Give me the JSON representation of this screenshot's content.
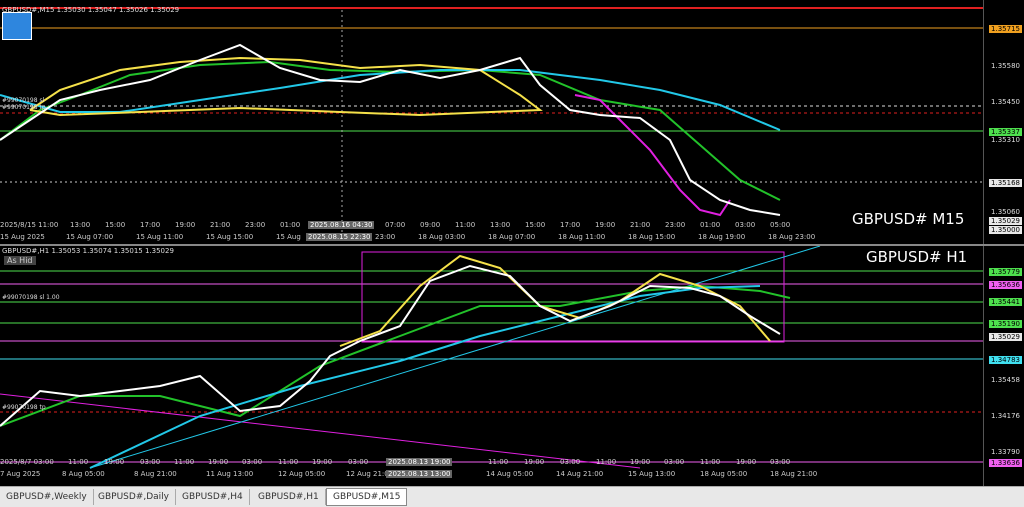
{
  "colors": {
    "yellow": "#f5e14a",
    "green": "#22c22a",
    "cyan": "#22c8e8",
    "magenta": "#e020e0",
    "white": "#ffffff",
    "badge_orange": "#f0a020",
    "badge_green": "#4ee04e",
    "badge_cyan": "#40e0f0",
    "badge_magenta": "#f060f0",
    "badge_white": "#e8e8e8"
  },
  "top": {
    "header": "GBPUSD#,M15  1.35030 1.35047 1.35026 1.35029",
    "title": "GBPUSD# M15",
    "line_labels": [
      "#99070198 sl",
      "#99070198 tp"
    ],
    "prices": [
      "1.35580",
      "1.35450",
      "1.35310",
      "1.35060"
    ],
    "badges": [
      {
        "text": "1.35715",
        "color": "badge_orange"
      },
      {
        "text": "1.35337",
        "color": "badge_green"
      },
      {
        "text": "1.35168",
        "color": "badge_white"
      },
      {
        "text": "1.35029",
        "color": "badge_white"
      },
      {
        "text": "1.35000",
        "color": "badge_white"
      }
    ],
    "time_row1": [
      "2025/8/15 11:00",
      "13:00",
      "15:00",
      "17:00",
      "19:00",
      "21:00",
      "23:00",
      "01:00",
      "2025.08.16 04:30",
      "07:00",
      "09:00",
      "11:00",
      "13:00",
      "15:00",
      "17:00",
      "19:00",
      "21:00",
      "23:00",
      "01:00",
      "03:00",
      "05:00"
    ],
    "time_row2": [
      "15 Aug 2025",
      "15 Aug 07:00",
      "15 Aug 11:00",
      "15 Aug 15:00",
      "15 Aug",
      "2025.08.15 22:30",
      "23:00",
      "18 Aug 03:00",
      "18 Aug 07:00",
      "18 Aug 11:00",
      "18 Aug 15:00",
      "18 Aug 19:00",
      "18 Aug 23:00"
    ]
  },
  "bottom": {
    "header": "GBPUSD#,H1  1.35053 1.35074 1.35015 1.35029",
    "title": "GBPUSD# H1",
    "as_label": "As Hid",
    "line_labels": [
      "#99070198 sl 1.00",
      "#99070198 tp"
    ],
    "prices": [
      "1.35458",
      "1.34176",
      "1.33790"
    ],
    "badges": [
      {
        "text": "1.35779",
        "color": "badge_green"
      },
      {
        "text": "1.35636",
        "color": "badge_magenta"
      },
      {
        "text": "1.35441",
        "color": "badge_green"
      },
      {
        "text": "1.35190",
        "color": "badge_green"
      },
      {
        "text": "1.35029",
        "color": "badge_white"
      },
      {
        "text": "1.34783",
        "color": "badge_cyan"
      },
      {
        "text": "1.33636",
        "color": "badge_magenta"
      }
    ],
    "time_row1": [
      "2025/8/7 03:00",
      "11:00",
      "19:00",
      "03:00",
      "11:00",
      "19:00",
      "03:00",
      "11:00",
      "19:00",
      "03:00",
      "2025.08.13 19:00",
      "11:00",
      "19:00",
      "03:00",
      "11:00",
      "19:00",
      "03:00",
      "11:00",
      "19:00",
      "03:00"
    ],
    "time_row2": [
      "7 Aug 2025",
      "8 Aug 05:00",
      "8 Aug 21:00",
      "11 Aug 13:00",
      "12 Aug 05:00",
      "12 Aug 21:00",
      "2025.08.13 13:00",
      "14 Aug 05:00",
      "14 Aug 21:00",
      "15 Aug 13:00",
      "18 Aug 05:00",
      "18 Aug 21:00"
    ]
  },
  "tabs": [
    "GBPUSD#,Weekly",
    "GBPUSD#,Daily",
    "GBPUSD#,H4",
    "GBPUSD#,H1",
    "GBPUSD#,M15"
  ],
  "active_tab": "GBPUSD#,M15"
}
